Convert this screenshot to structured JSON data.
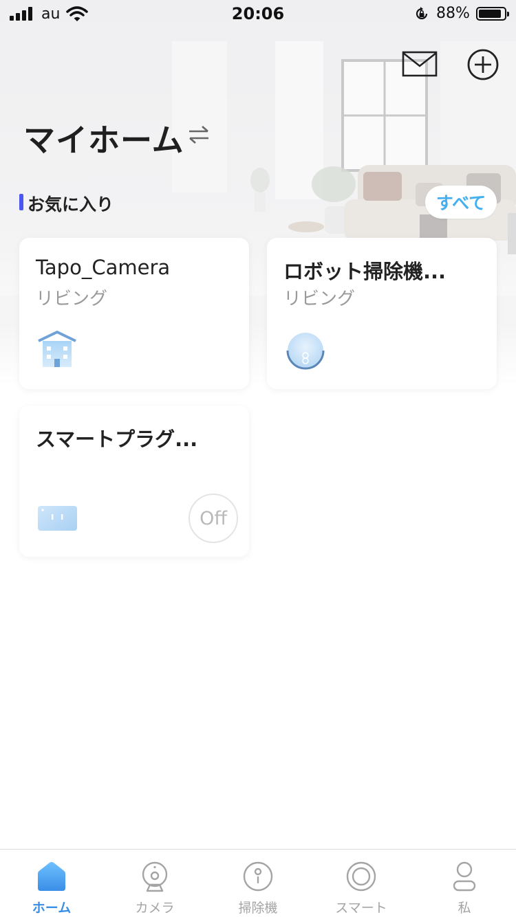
{
  "status_bar": {
    "carrier": "au",
    "time": "20:06",
    "battery_percent": "88%",
    "battery_level": 0.88
  },
  "header": {
    "title": "マイホーム",
    "mail_icon": "mail-icon",
    "add_icon": "plus-circle-icon",
    "switch_icon": "swap-arrows-icon"
  },
  "favorites": {
    "label": "お気に入り",
    "see_all_label": "すべて",
    "accent_color": "#4b56f2",
    "link_color": "#43aef0"
  },
  "devices": [
    {
      "name": "Tapo_Camera",
      "room": "リビング",
      "icon": "house-icon"
    },
    {
      "name": "ロボット掃除機...",
      "room": "リビング",
      "icon": "robot-vacuum-icon"
    },
    {
      "name": "スマートプラグ...",
      "room": "",
      "icon": "smart-plug-icon",
      "power_label": "Off"
    }
  ],
  "tabs": [
    {
      "label": "ホーム",
      "icon": "home-icon",
      "active": true
    },
    {
      "label": "カメラ",
      "icon": "camera-icon",
      "active": false
    },
    {
      "label": "掃除機",
      "icon": "vacuum-icon",
      "active": false
    },
    {
      "label": "スマート",
      "icon": "smart-icon",
      "active": false
    },
    {
      "label": "私",
      "icon": "person-icon",
      "active": false
    }
  ],
  "colors": {
    "tab_active": "#3a8ee6",
    "tab_inactive": "#a4a4a4"
  }
}
